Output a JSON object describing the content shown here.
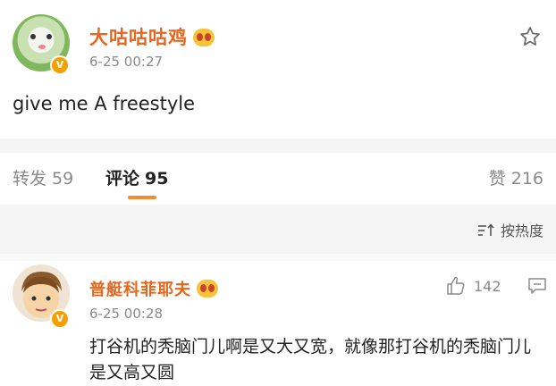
{
  "post": {
    "username": "大咕咕咕鸡",
    "time": "6-25 00:27",
    "content": "give me A freestyle",
    "verified_badge": "V",
    "icons": [
      "avatar",
      "verified-badge-icon",
      "member-badge-icon",
      "star-icon"
    ]
  },
  "tabs": {
    "repost_label": "转发",
    "repost_count": "59",
    "comment_label": "评论",
    "comment_count": "95",
    "like_label": "赞",
    "like_count": "216"
  },
  "sort": {
    "label": "按热度",
    "icon": "sort-icon"
  },
  "comment": {
    "username": "普艇科菲耶夫",
    "time": "6-25 00:28",
    "like_count": "142",
    "text": "打谷机的秃脑门儿啊是又大又宽，就像那打谷机的秃脑门儿是又高又圆",
    "verified_badge": "V",
    "icons": [
      "avatar",
      "verified-badge-icon",
      "member-badge-icon",
      "thumb-up-icon",
      "reply-icon"
    ]
  },
  "colors": {
    "username": "#e8661c",
    "accent": "#f28b2f",
    "muted": "#8a8a8a",
    "separator": "#f5f5f5",
    "badge": "#f6a000"
  }
}
